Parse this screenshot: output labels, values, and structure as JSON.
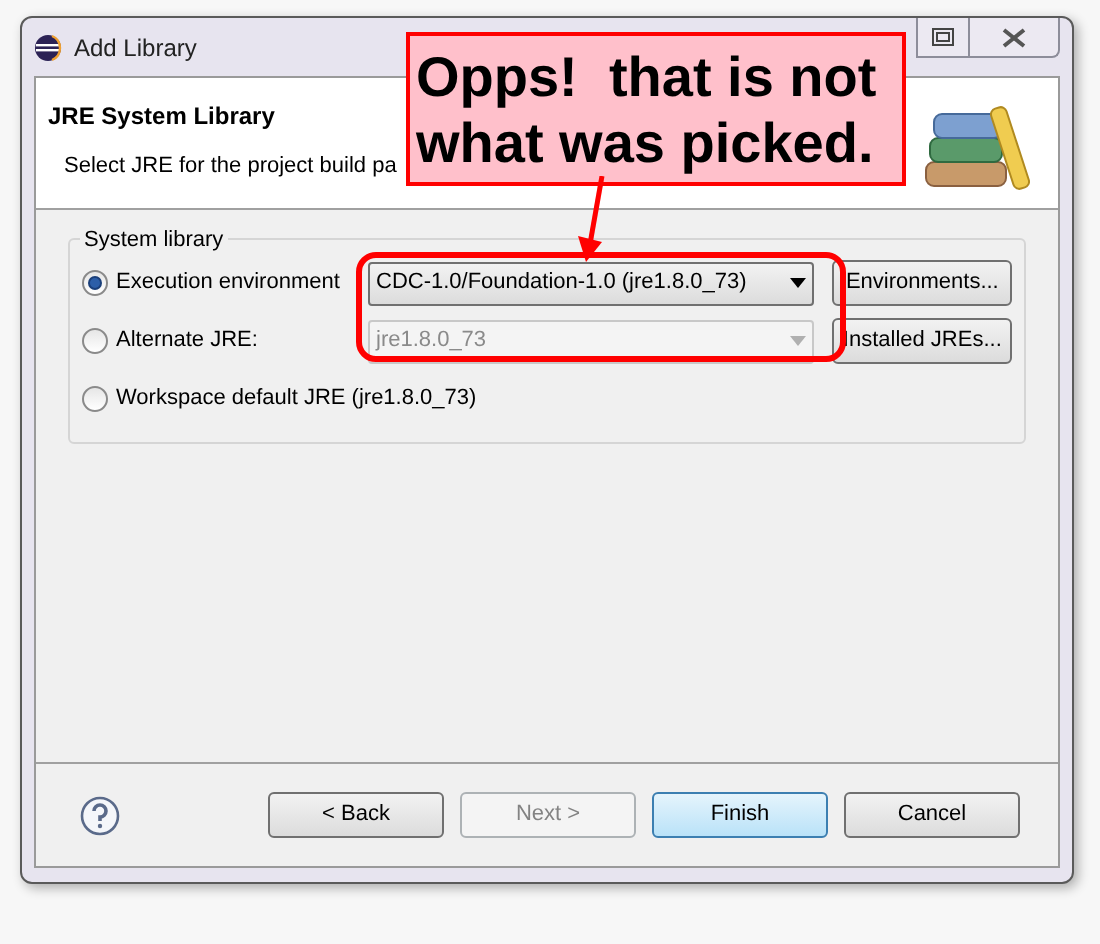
{
  "window": {
    "title": "Add Library"
  },
  "header": {
    "title": "JRE System Library",
    "description": "Select JRE for the project build pa"
  },
  "group": {
    "label": "System library",
    "options": [
      {
        "kind": "combo",
        "label": "Execution environment",
        "selected": true,
        "value": "CDC-1.0/Foundation-1.0 (jre1.8.0_73)",
        "disabled": false,
        "button": "Environments..."
      },
      {
        "kind": "combo",
        "label": "Alternate JRE:",
        "selected": false,
        "value": "jre1.8.0_73",
        "disabled": true,
        "button": "Installed JREs..."
      },
      {
        "kind": "plain",
        "label": "Workspace default JRE (jre1.8.0_73)",
        "selected": false
      }
    ]
  },
  "buttons": [
    {
      "label": "< Back",
      "disabled": false,
      "default": false
    },
    {
      "label": "Next >",
      "disabled": true,
      "default": false
    },
    {
      "label": "Finish",
      "disabled": false,
      "default": true
    },
    {
      "label": "Cancel",
      "disabled": false,
      "default": false
    }
  ],
  "callout": {
    "lines": [
      "Opps!  that is not",
      "what was picked."
    ]
  }
}
